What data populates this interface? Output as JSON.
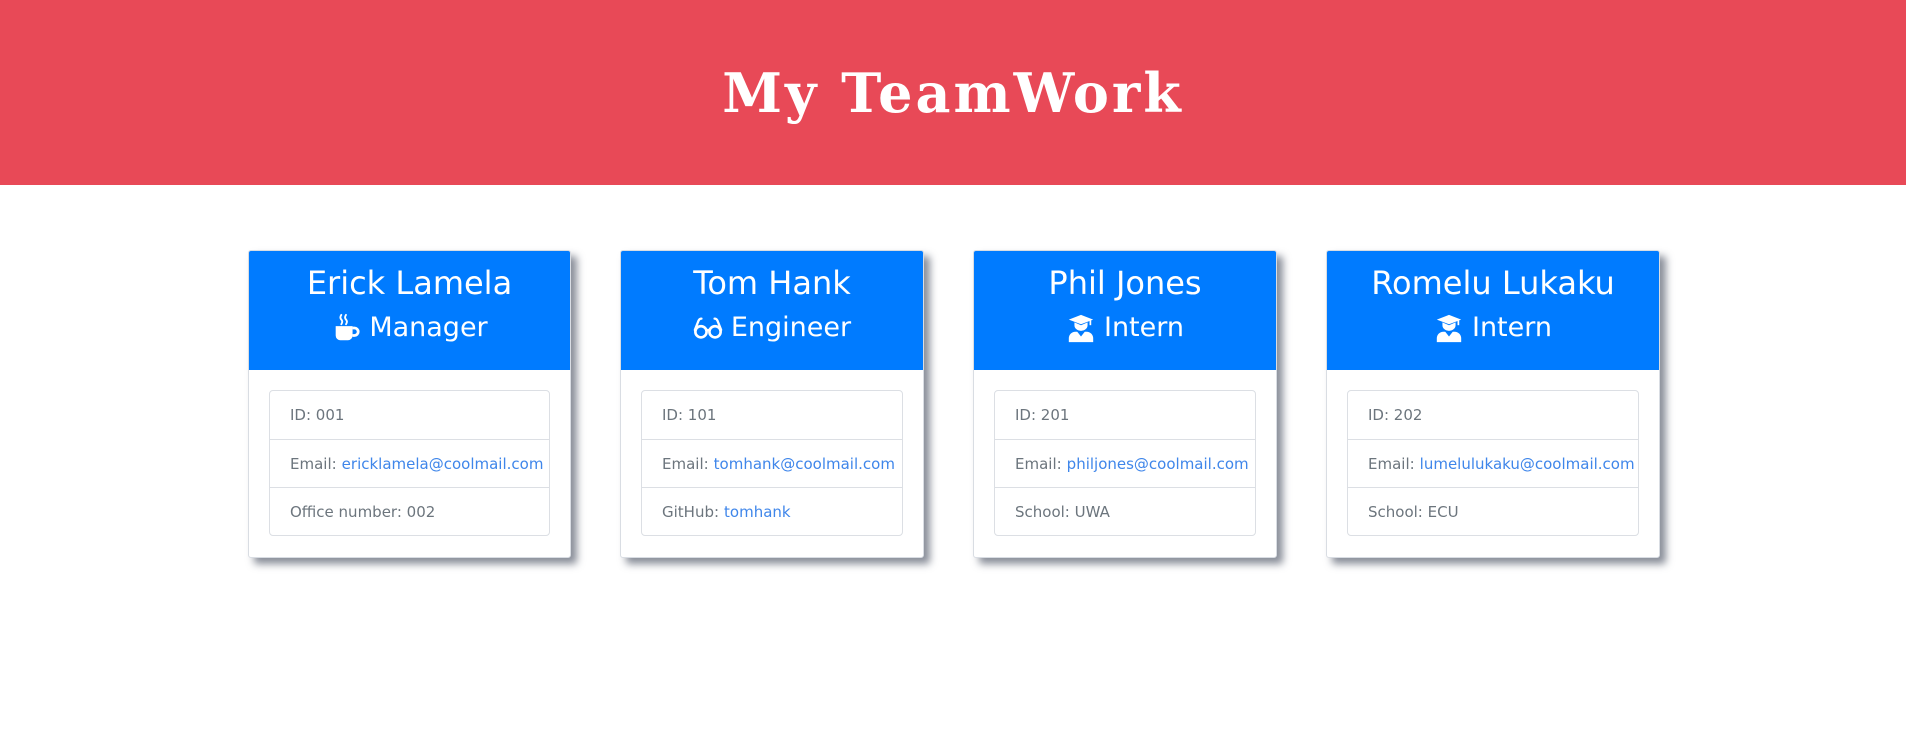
{
  "header": {
    "title": "My TeamWork"
  },
  "colors": {
    "header_bg": "#e84957",
    "card_head_bg": "#007bff",
    "link": "#3f86ea",
    "muted_text": "#6c757d"
  },
  "members": [
    {
      "name": "Erick Lamela",
      "role": "Manager",
      "role_icon": "coffee-mug-icon",
      "id_label": "ID: 001",
      "email_label": "Email:",
      "email": "ericklamela@coolmail.com",
      "extra_label": "Office number: 002"
    },
    {
      "name": "Tom Hank",
      "role": "Engineer",
      "role_icon": "glasses-icon",
      "id_label": "ID: 101",
      "email_label": "Email:",
      "email": "tomhank@coolmail.com",
      "extra_prefix": "GitHub:",
      "extra_link": "tomhank"
    },
    {
      "name": "Phil Jones",
      "role": "Intern",
      "role_icon": "graduate-icon",
      "id_label": "ID: 201",
      "email_label": "Email:",
      "email": "philjones@coolmail.com",
      "extra_label": "School: UWA"
    },
    {
      "name": "Romelu Lukaku",
      "role": "Intern",
      "role_icon": "graduate-icon",
      "id_label": "ID: 202",
      "email_label": "Email:",
      "email": "lumelulukaku@coolmail.com",
      "extra_label": "School: ECU"
    }
  ]
}
